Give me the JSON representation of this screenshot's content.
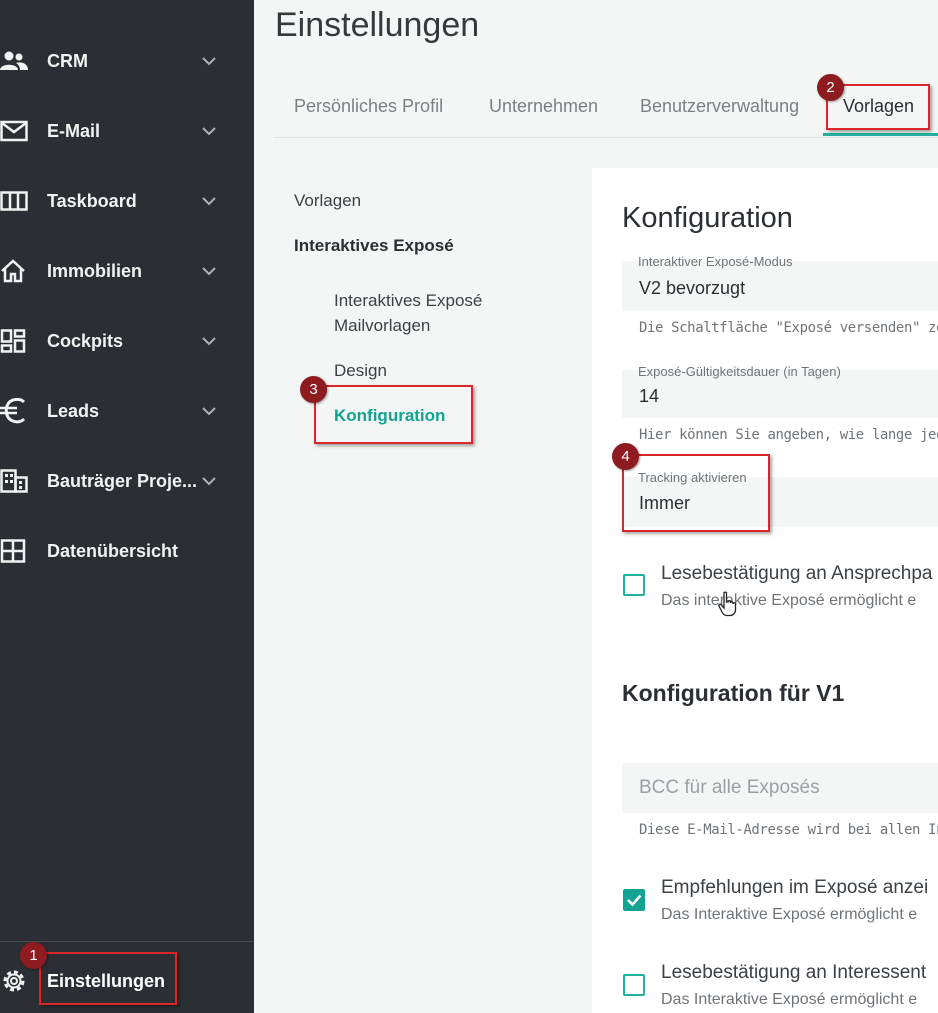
{
  "sidebar": {
    "items": [
      {
        "label": "CRM",
        "icon": "contacts-icon"
      },
      {
        "label": "E-Mail",
        "icon": "mail-icon"
      },
      {
        "label": "Taskboard",
        "icon": "taskboard-icon"
      },
      {
        "label": "Immobilien",
        "icon": "home-icon"
      },
      {
        "label": "Cockpits",
        "icon": "dashboard-icon"
      },
      {
        "label": "Leads",
        "icon": "euro-icon"
      },
      {
        "label": "Bauträger Proje...",
        "icon": "building-icon"
      },
      {
        "label": "Datenübersicht",
        "icon": "grid-icon"
      }
    ],
    "settings_label": "Einstellungen"
  },
  "header": {
    "title": "Einstellungen"
  },
  "tabs": [
    {
      "label": "Persönliches Profil"
    },
    {
      "label": "Unternehmen"
    },
    {
      "label": "Benutzerverwaltung"
    },
    {
      "label": "Vorlagen"
    }
  ],
  "subnav": {
    "vorlagen": "Vorlagen",
    "interaktives_expose": "Interaktives Exposé",
    "mailvorlagen_line1": "Interaktives Exposé",
    "mailvorlagen_line2": "Mailvorlagen",
    "design": "Design",
    "konfiguration": "Konfiguration"
  },
  "config": {
    "title": "Konfiguration",
    "mode_label": "Interaktiver Exposé-Modus",
    "mode_value": "V2 bevorzugt",
    "mode_hint": "Die Schaltfläche \"Exposé versenden\" zeigt",
    "validity_label": "Exposé-Gültigkeitsdauer (in Tagen)",
    "validity_value": "14",
    "validity_hint": "Hier können Sie angeben, wie lange jedes",
    "tracking_label": "Tracking aktivieren",
    "tracking_value": "Immer",
    "read_receipt_title": "Lesebestätigung an Ansprechpa",
    "read_receipt_desc": "Das interaktive Exposé ermöglicht e"
  },
  "config_v1": {
    "title": "Konfiguration für V1",
    "bcc_placeholder": "BCC für alle Exposés",
    "bcc_hint": "Diese E-Mail-Adresse wird bei allen Interak",
    "recommend_title": "Empfehlungen im Exposé anzei",
    "recommend_desc": "Das Interaktive Exposé ermöglicht e",
    "recommend_checked": true,
    "interest_title": "Lesebestätigung an Interessent",
    "interest_desc": "Das Interaktive Exposé ermöglicht e",
    "interest_checked": false
  },
  "annotations": [
    "1",
    "2",
    "3",
    "4"
  ],
  "colors": {
    "sidebar_bg": "#2b2f33",
    "accent": "#13a393",
    "annotation_red": "#d8262b",
    "badge": "#8e1b1f"
  }
}
